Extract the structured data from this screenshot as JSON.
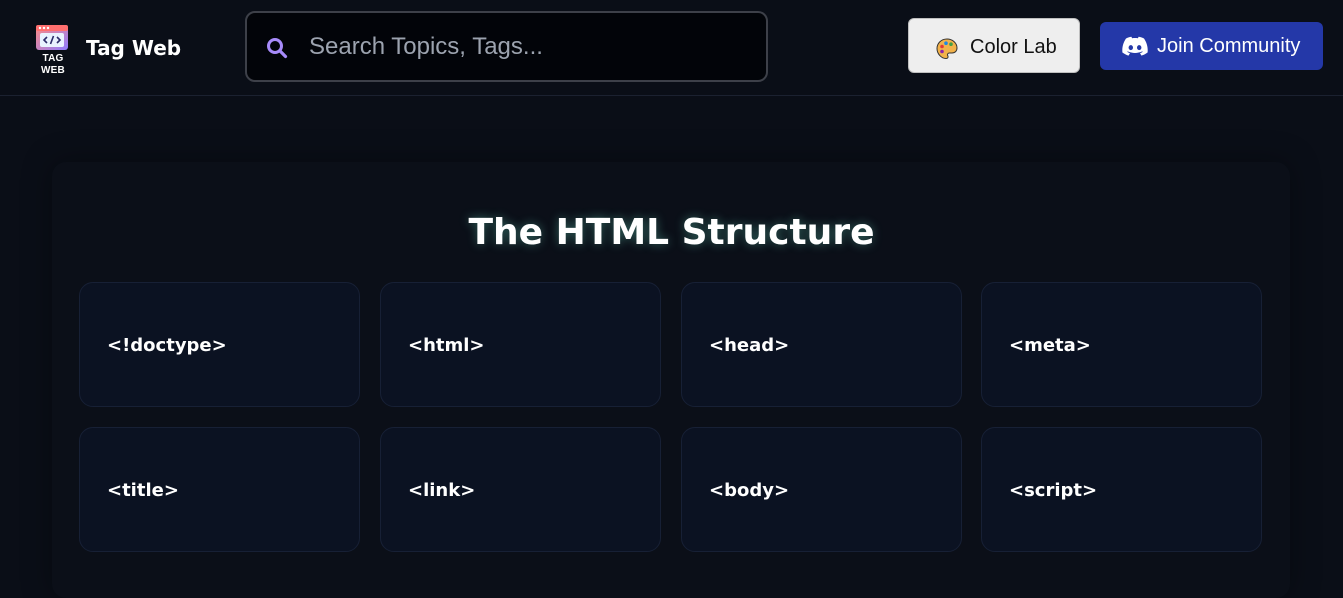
{
  "navbar": {
    "logo_text": "TAG WEB",
    "brand_name": "Tag Web",
    "search": {
      "placeholder": "Search Topics, Tags...",
      "value": ""
    },
    "color_lab_label": "Color Lab",
    "join_label": "Join Community"
  },
  "main": {
    "title": "The HTML Structure",
    "cards": [
      {
        "label": "<!doctype>"
      },
      {
        "label": "<html>"
      },
      {
        "label": "<head>"
      },
      {
        "label": "<meta>"
      },
      {
        "label": "<title>"
      },
      {
        "label": "<link>"
      },
      {
        "label": "<body>"
      },
      {
        "label": "<script>"
      }
    ]
  },
  "icons": {
    "logo": "code-window-icon",
    "search": "search-icon",
    "color_lab": "palette-icon",
    "join": "discord-icon"
  },
  "colors": {
    "background": "#0a0e17",
    "search_bg": "#020409",
    "card_bg": "#0b1222",
    "join_button": "#2438a8",
    "color_lab_button": "#eeeeee",
    "search_icon": "#a78bfa"
  }
}
